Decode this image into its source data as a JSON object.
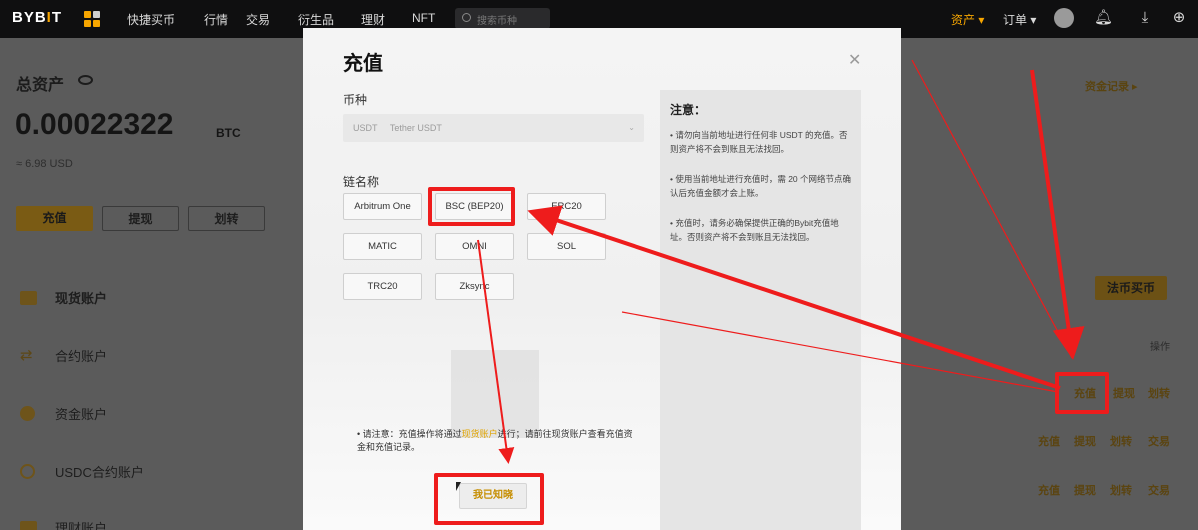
{
  "topnav": {
    "logo_main": "BYB",
    "logo_dot": "I",
    "logo_end": "T",
    "items": [
      "快捷买币",
      "行情",
      "交易",
      "衍生品",
      "理财",
      "NFT"
    ],
    "search_placeholder": "搜索币种",
    "assets": "资产",
    "orders": "订单",
    "icons": [
      "grid-icon",
      "search-icon",
      "bell-icon",
      "download-icon",
      "globe-icon"
    ]
  },
  "background": {
    "total_label": "总资产",
    "amount": "0.00022322",
    "unit": "BTC",
    "usd": "≈ 6.98 USD",
    "buttons": [
      "充值",
      "提现",
      "划转"
    ],
    "accounts": [
      "现货账户",
      "合约账户",
      "资金账户",
      "USDC合约账户",
      "理财账户"
    ],
    "record_link": "资金记录 ▸",
    "buy_button": "法币买币",
    "op_header": "操作",
    "row1": [
      "充值",
      "提现",
      "划转"
    ],
    "row2": [
      "充值",
      "提现",
      "划转",
      "交易"
    ],
    "row3": [
      "充值",
      "提现",
      "划转",
      "交易"
    ]
  },
  "modal": {
    "title": "充值",
    "coin_label": "币种",
    "coin_symbol": "USDT",
    "coin_name": "Tether USDT",
    "chain_label": "链名称",
    "chains": [
      "Arbitrum One",
      "BSC (BEP20)",
      "ERC20",
      "MATIC",
      "OMNI",
      "SOL",
      "TRC20",
      "Zksync"
    ],
    "notice_prefix": "• 请注意：充值操作将通过",
    "notice_highlight": "现货账户",
    "notice_suffix": "进行；请前往现货账户查看充值资金和充值记录。",
    "ok_button": "我已知晓",
    "notes_title": "注意：",
    "notes": [
      "• 请勿向当前地址进行任何非 USDT 的充值。否则资产将不会到账且无法找回。",
      "• 使用当前地址进行充值时，需 20 个网络节点确认后充值金额才会上账。",
      "• 充值时，请务必确保提供正确的Bybit充值地址。否则资产将不会到账且无法找回。"
    ]
  },
  "colors": {
    "accent": "#f7a600",
    "annotation": "#ee1c1c"
  }
}
